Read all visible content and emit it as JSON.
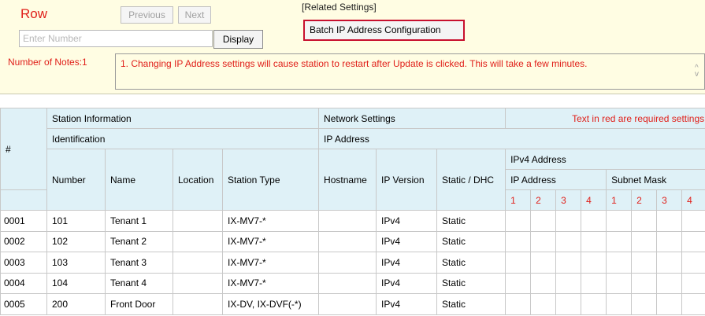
{
  "controls": {
    "row_label": "Row",
    "previous_label": "Previous",
    "next_label": "Next",
    "number_placeholder": "Enter Number",
    "display_label": "Display"
  },
  "related": {
    "heading": "[Related Settings]",
    "batch_label": "Batch IP Address Configuration"
  },
  "notes": {
    "label": "Number of Notes:1",
    "text": "1. Changing IP Address settings will cause station to restart after Update is clicked. This will take a few minutes."
  },
  "table": {
    "hash": "#",
    "station_information": "Station Information",
    "network_settings": "Network Settings",
    "required_note": "Text in red are required settings",
    "identification": "Identification",
    "ip_address_group": "IP Address",
    "ipv4_address": "IPv4 Address",
    "col_number": "Number",
    "col_name": "Name",
    "col_location": "Location",
    "col_station_type": "Station Type",
    "col_hostname": "Hostname",
    "col_ip_version": "IP Version",
    "col_static_dhcp": "Static / DHC",
    "ip_address_sub": "IP Address",
    "subnet_mask": "Subnet Mask",
    "octets": [
      "1",
      "2",
      "3",
      "4"
    ],
    "rows": [
      {
        "id": "0001",
        "number": "101",
        "name": "Tenant 1",
        "location": "",
        "type": "IX-MV7-*",
        "hostname": "",
        "ipver": "IPv4",
        "mode": "Static"
      },
      {
        "id": "0002",
        "number": "102",
        "name": "Tenant 2",
        "location": "",
        "type": "IX-MV7-*",
        "hostname": "",
        "ipver": "IPv4",
        "mode": "Static"
      },
      {
        "id": "0003",
        "number": "103",
        "name": "Tenant 3",
        "location": "",
        "type": "IX-MV7-*",
        "hostname": "",
        "ipver": "IPv4",
        "mode": "Static"
      },
      {
        "id": "0004",
        "number": "104",
        "name": "Tenant 4",
        "location": "",
        "type": "IX-MV7-*",
        "hostname": "",
        "ipver": "IPv4",
        "mode": "Static"
      },
      {
        "id": "0005",
        "number": "200",
        "name": "Front Door",
        "location": "",
        "type": "IX-DV, IX-DVF(-*)",
        "hostname": "",
        "ipver": "IPv4",
        "mode": "Static"
      }
    ]
  }
}
